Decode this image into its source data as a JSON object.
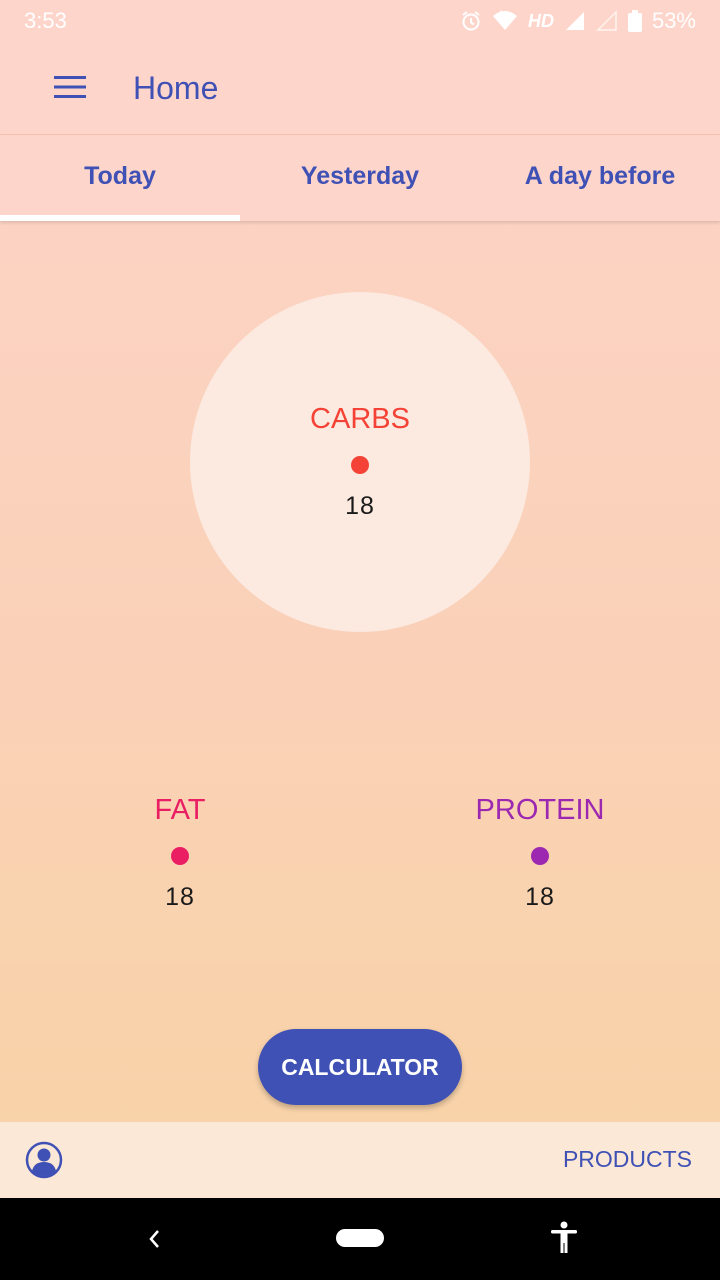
{
  "status_bar": {
    "time": "3:53",
    "network_label": "HD",
    "battery": "53%"
  },
  "app_bar": {
    "title": "Home",
    "menu_icon": "menu-icon"
  },
  "tabs": [
    {
      "label": "Today",
      "selected": true
    },
    {
      "label": "Yesterday",
      "selected": false
    },
    {
      "label": "A day before",
      "selected": false
    }
  ],
  "macros": {
    "carbs": {
      "label": "CARBS",
      "value": "18",
      "color": "#f44336"
    },
    "fat": {
      "label": "FAT",
      "value": "18",
      "color": "#e91e63"
    },
    "protein": {
      "label": "PROTEIN",
      "value": "18",
      "color": "#9c27b0"
    }
  },
  "actions": {
    "calculator_label": "CALCULATOR",
    "products_label": "PRODUCTS",
    "profile_icon": "account-circle-icon"
  },
  "colors": {
    "primary": "#3f51b5",
    "background_top": "#fdd4c8",
    "background_bottom": "#f8d3a3"
  }
}
